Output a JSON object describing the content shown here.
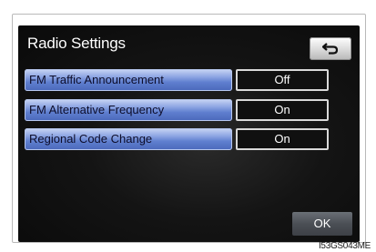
{
  "screen": {
    "title": "Radio Settings",
    "back_icon": "return-arrow-icon",
    "rows": [
      {
        "label": "FM Traffic Announcement",
        "value": "Off"
      },
      {
        "label": "FM Alternative Frequency",
        "value": "On"
      },
      {
        "label": "Regional Code Change",
        "value": "On"
      }
    ],
    "ok_label": "OK"
  },
  "image_code": "I53GS043ME",
  "colors": {
    "label_blue": "#5f7fcf",
    "screen_bg": "#141414",
    "ok_gray": "#4b4f55"
  }
}
